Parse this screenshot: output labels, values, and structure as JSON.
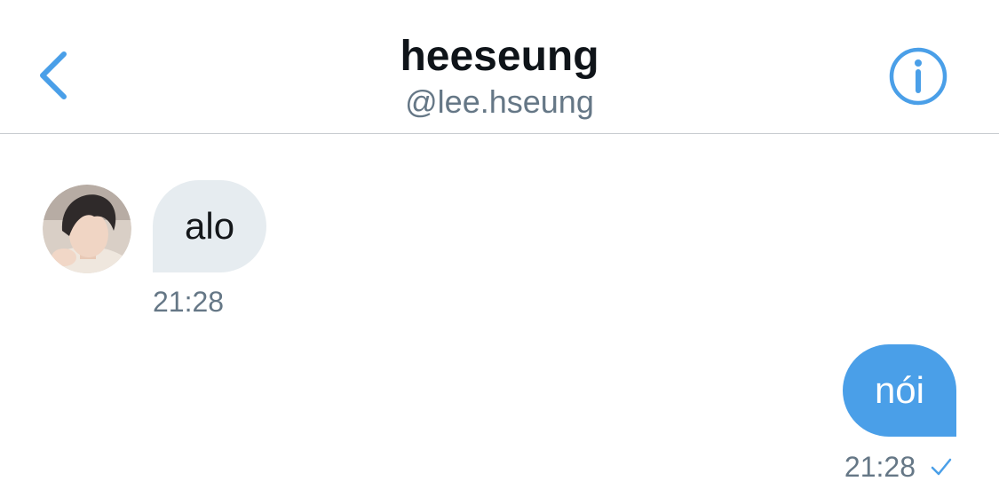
{
  "header": {
    "title": "heeseung",
    "handle": "@lee.hseung"
  },
  "messages": [
    {
      "direction": "incoming",
      "text": "alo",
      "time": "21:28"
    },
    {
      "direction": "outgoing",
      "text": "nói",
      "time": "21:28",
      "status": "sent"
    }
  ],
  "colors": {
    "accent": "#4a9fe8",
    "incoming_bubble": "#e6ecf0",
    "muted_text": "#657786"
  },
  "icons": {
    "back": "chevron-left-icon",
    "info": "info-circle-icon",
    "sent": "check-icon"
  }
}
